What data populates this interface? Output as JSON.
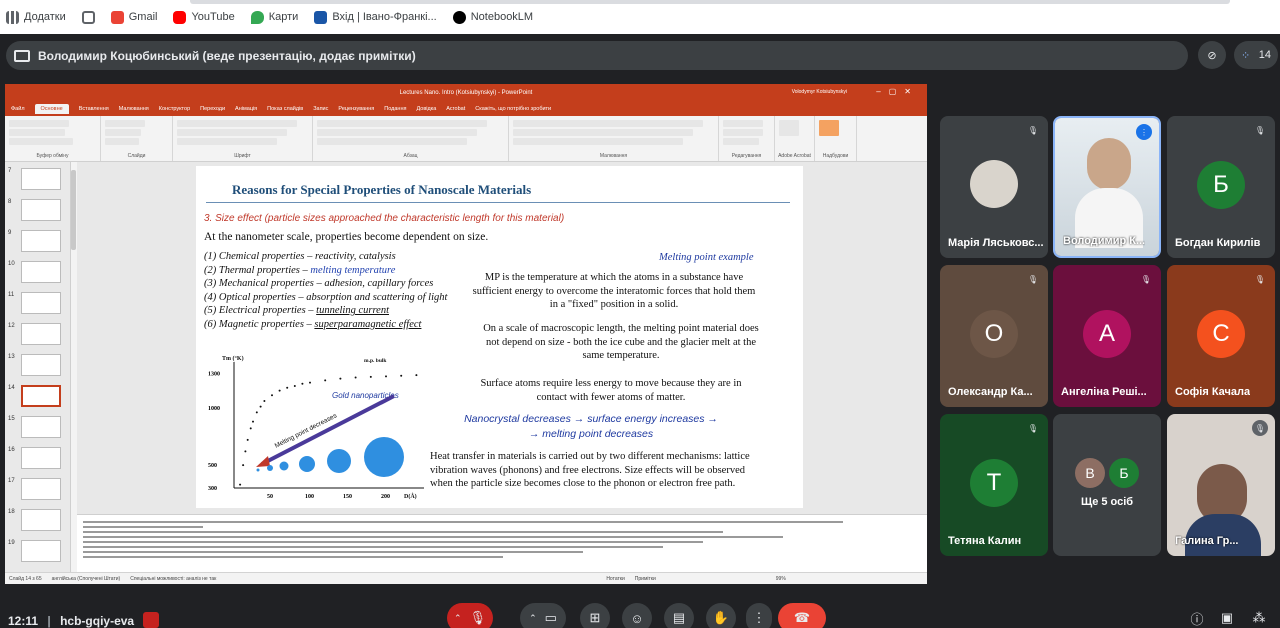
{
  "browser": {
    "bookmarks": [
      {
        "label": "Додатки",
        "icon": "apps-grid-icon"
      },
      {
        "label": "",
        "icon": "grid-icon"
      },
      {
        "label": "Gmail",
        "icon": "gmail-icon"
      },
      {
        "label": "YouTube",
        "icon": "youtube-icon"
      },
      {
        "label": "Карти",
        "icon": "maps-icon"
      },
      {
        "label": "Вхід | Івано-Франкі...",
        "icon": "coat-of-arms-icon"
      },
      {
        "label": "NotebookLM",
        "icon": "notebooklm-icon"
      }
    ]
  },
  "meet": {
    "presenter_text": "Володимир Коцюбинський (веде презентацію, додає примітки)",
    "participant_count": "14",
    "meeting_time": "12:11",
    "meeting_code": "hcb-gqiy-eva",
    "participants": [
      {
        "name": "Марія Ляськовс...",
        "initial": "",
        "muted": true,
        "color": "#4a3f35"
      },
      {
        "name": "Володимир К...",
        "initial": "",
        "muted": false,
        "color": "#dfe6ec"
      },
      {
        "name": "Богдан Кирилів",
        "initial": "Б",
        "muted": true,
        "color": "#1e7e34"
      },
      {
        "name": "Олександр Ка...",
        "initial": "О",
        "muted": true,
        "color": "#5f4b3e"
      },
      {
        "name": "Ангеліна Реші...",
        "initial": "А",
        "muted": true,
        "color": "#b0125f"
      },
      {
        "name": "Софія Качала",
        "initial": "С",
        "muted": true,
        "color": "#f4511e"
      },
      {
        "name": "Тетяна Калин",
        "initial": "Т",
        "muted": true,
        "color": "#1e7e34"
      },
      {
        "name": "Ще 5 осіб",
        "initial": "",
        "muted": false,
        "color": "#3c4043"
      },
      {
        "name": "Галина Гр...",
        "initial": "",
        "muted": true,
        "color": "#d8d2cc"
      }
    ],
    "more_initials": [
      "В",
      "Б"
    ]
  },
  "ppt": {
    "window_title": "Lectures Nano. Intro (Kotsiubynskyi) - PowerPoint",
    "user": "Volodymyr Kotsiubynskyi",
    "tabs": [
      "Файл",
      "Основне",
      "Вставлення",
      "Малювання",
      "Конструктор",
      "Переходи",
      "Анімація",
      "Показ слайдів",
      "Запис",
      "Рецензування",
      "Подання",
      "Довідка",
      "Acrobat",
      "Скажіть, що потрібно зробити"
    ],
    "ribbon_groups": [
      "Буфер обміну",
      "Слайди",
      "Шрифт",
      "Абзац",
      "Малювання",
      "Редагування",
      "Adobe Acrobat",
      "Надбудови"
    ],
    "thumb_numbers": [
      "7",
      "8",
      "9",
      "10",
      "11",
      "12",
      "13",
      "14",
      "15",
      "16",
      "17",
      "18",
      "19"
    ],
    "status_left": "Слайд 14 з 65",
    "status_lang": "англійська (Сполучені Штати)",
    "status_access": "Спеціальні можливості: аналіз не так",
    "status_notes": "Нотатки",
    "status_comments": "Примітки",
    "zoom": "99%"
  },
  "slide": {
    "title": "Reasons for Special Properties of Nanoscale Materials",
    "subtitle": "3. Size effect (particle sizes approached the characteristic length for this material)",
    "intro": "At the nanometer scale, properties become dependent on size.",
    "properties": [
      {
        "label": "(1) Chemical properties – ",
        "value": "reactivity, catalysis",
        "style": ""
      },
      {
        "label": "(2) Thermal properties – ",
        "value": "melting temperature",
        "style": "hl"
      },
      {
        "label": "(3) Mechanical properties – ",
        "value": "adhesion, capillary forces",
        "style": ""
      },
      {
        "label": "(4) Optical properties – ",
        "value": "absorption and scattering of light",
        "style": ""
      },
      {
        "label": "(5) Electrical properties – ",
        "value": "tunneling current",
        "style": "ul"
      },
      {
        "label": "(6) Magnetic properties – ",
        "value": "superparamagnetic effect",
        "style": "ul"
      }
    ],
    "mp_heading": "Melting point example",
    "para1": "MP is the temperature at which the atoms in a substance have sufficient energy to overcome the interatomic forces that hold them in a \"fixed\" position in a solid.",
    "para2": "On a scale of macroscopic length, the melting point material does not depend on size - both the ice cube and the glacier melt at the same temperature.",
    "para3": "Surface atoms require less energy to move because they are in contact with fewer atoms of matter.",
    "chain_line1": "Nanocrystal decreases → surface energy increases →",
    "chain_line2": "→ melting point decreases",
    "heat": "Heat transfer in materials is carried out by two different mechanisms: lattice vibration waves (phonons) and free electrons. Size effects will be observed when the particle size becomes close to the phonon or electron free path."
  },
  "chart_data": {
    "type": "scatter",
    "ylabel": "Tm (°K)",
    "xlabel": "D(Å)",
    "xticks": [
      "50",
      "100",
      "150",
      "200"
    ],
    "yticks": [
      "300",
      "500",
      "1000",
      "1300"
    ],
    "x": [
      8,
      12,
      15,
      18,
      22,
      25,
      30,
      35,
      40,
      50,
      60,
      70,
      80,
      90,
      100,
      120,
      140,
      160,
      180,
      200,
      220,
      240
    ],
    "y": [
      330,
      500,
      620,
      720,
      820,
      880,
      960,
      1010,
      1060,
      1110,
      1150,
      1175,
      1190,
      1210,
      1220,
      1240,
      1255,
      1265,
      1270,
      1275,
      1280,
      1285
    ],
    "xlim": [
      0,
      250
    ],
    "ylim": [
      300,
      1400
    ],
    "bulk_label": "m.p. bulk",
    "annotation": "Gold nanoparticles",
    "arrow_label": "Melting point decreases"
  }
}
